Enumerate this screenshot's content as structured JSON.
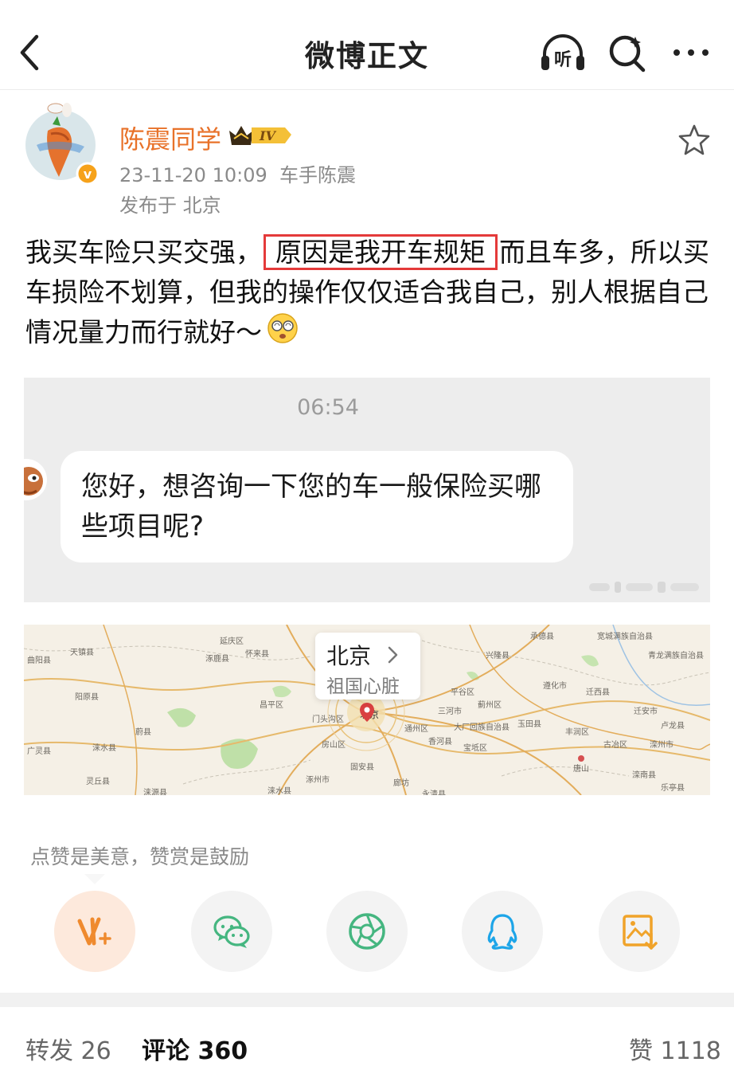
{
  "header": {
    "title": "微博正文",
    "listen_label": "听"
  },
  "post": {
    "author": "陈震同学",
    "vip_level": "IV",
    "meta": "23-11-20 10:09  车手陈震",
    "location": "发布于 北京",
    "text_before": "我买车险只买交强，",
    "text_highlight": "原因是我开车规矩",
    "text_after": "而且车多，所以买车损险不划算，但我的操作仅仅适合我自己，别人根据自己情况量力而行就好～"
  },
  "chat_image": {
    "time": "06:54",
    "message": "您好，想咨询一下您的车一般保险买哪些项目呢?"
  },
  "map": {
    "city": "北京",
    "subtitle": "祖国心脏",
    "labels": {
      "l1": "曲阳县",
      "l2": "天镇县",
      "l3": "涿鹿县",
      "l4": "怀来县",
      "l5": "延庆区",
      "l6": "承德县",
      "l7": "兴隆县",
      "l8": "宽城满族自治县",
      "l9": "青龙满族自治县",
      "l10": "阳原县",
      "l11": "平谷区",
      "l12": "遵化市",
      "l13": "迁西县",
      "l14": "蓟州区",
      "l15": "迁安市",
      "l16": "蔚县",
      "l17": "门头沟区",
      "l18": "北京",
      "l19": "三河市",
      "l20": "玉田县",
      "l21": "丰润区",
      "l22": "卢龙县",
      "l23": "广灵县",
      "l24": "房山区",
      "l25": "香河县",
      "l26": "宝坻区",
      "l27": "古冶区",
      "l28": "滦州市",
      "l29": "灵丘县",
      "l30": "涿州市",
      "l31": "廊坊",
      "l32": "唐山",
      "l33": "滦南县",
      "l34": "涞源县",
      "l35": "涞水县",
      "l36": "固安县",
      "l37": "乐亭县",
      "l38": "涞水县",
      "l39": "永清县",
      "l40": "大厂回族自治县",
      "l41": "通州区",
      "l42": "昌平区"
    }
  },
  "reward": {
    "hint": "点赞是美意，赞赏是鼓励"
  },
  "footer": {
    "reposts": "转发 26",
    "comments": "评论 360",
    "likes": "赞 1118"
  },
  "colors": {
    "accent": "#e8722a",
    "highlight_box": "#e43a3a",
    "wechat": "#45b680",
    "qq": "#1da5e8",
    "save": "#f0a32a"
  }
}
